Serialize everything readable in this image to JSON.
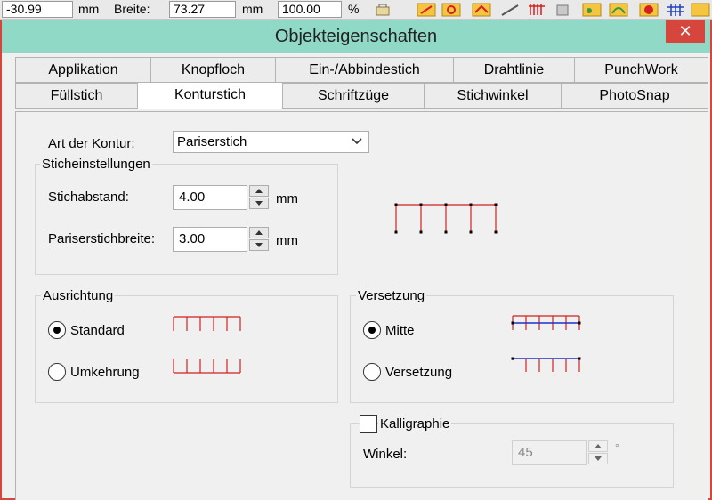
{
  "toolbar": {
    "value1": "-30.99",
    "unit1": "mm",
    "width_label": "Breite:",
    "width_value": "73.27",
    "unit2": "mm",
    "percent_value": "100.00",
    "percent_sign": "%"
  },
  "dialog": {
    "title": "Objekteigenschaften",
    "close_symbol": "✕"
  },
  "tabs": {
    "row_back": [
      "Applikation",
      "Knopfloch",
      "Ein-/Abbindestich",
      "Drahtlinie",
      "PunchWork"
    ],
    "row_front": [
      "Füllstich",
      "Konturstich",
      "Schriftzüge",
      "Stichwinkel",
      "PhotoSnap"
    ],
    "active": "Konturstich"
  },
  "contour": {
    "type_label": "Art der Kontur:",
    "type_value": "Pariserstich"
  },
  "stitch_settings": {
    "title": "Sticheinstellungen",
    "spacing_label": "Stichabstand:",
    "spacing_value": "4.00",
    "spacing_unit": "mm",
    "width_label": "Pariserstichbreite:",
    "width_value": "3.00",
    "width_unit": "mm"
  },
  "alignment": {
    "title": "Ausrichtung",
    "options": [
      "Standard",
      "Umkehrung"
    ],
    "selected": "Standard"
  },
  "offset": {
    "title": "Versetzung",
    "options": [
      "Mitte",
      "Versetzung"
    ],
    "selected": "Mitte"
  },
  "calligraphy": {
    "label": "Kalligraphie",
    "checked": false,
    "angle_label": "Winkel:",
    "angle_value": "45",
    "angle_unit": "°"
  },
  "colors": {
    "title_bar": "#8fd9c6",
    "close_button": "#d7463c",
    "stitch_red": "#d42020",
    "stitch_blue": "#2030c8"
  }
}
